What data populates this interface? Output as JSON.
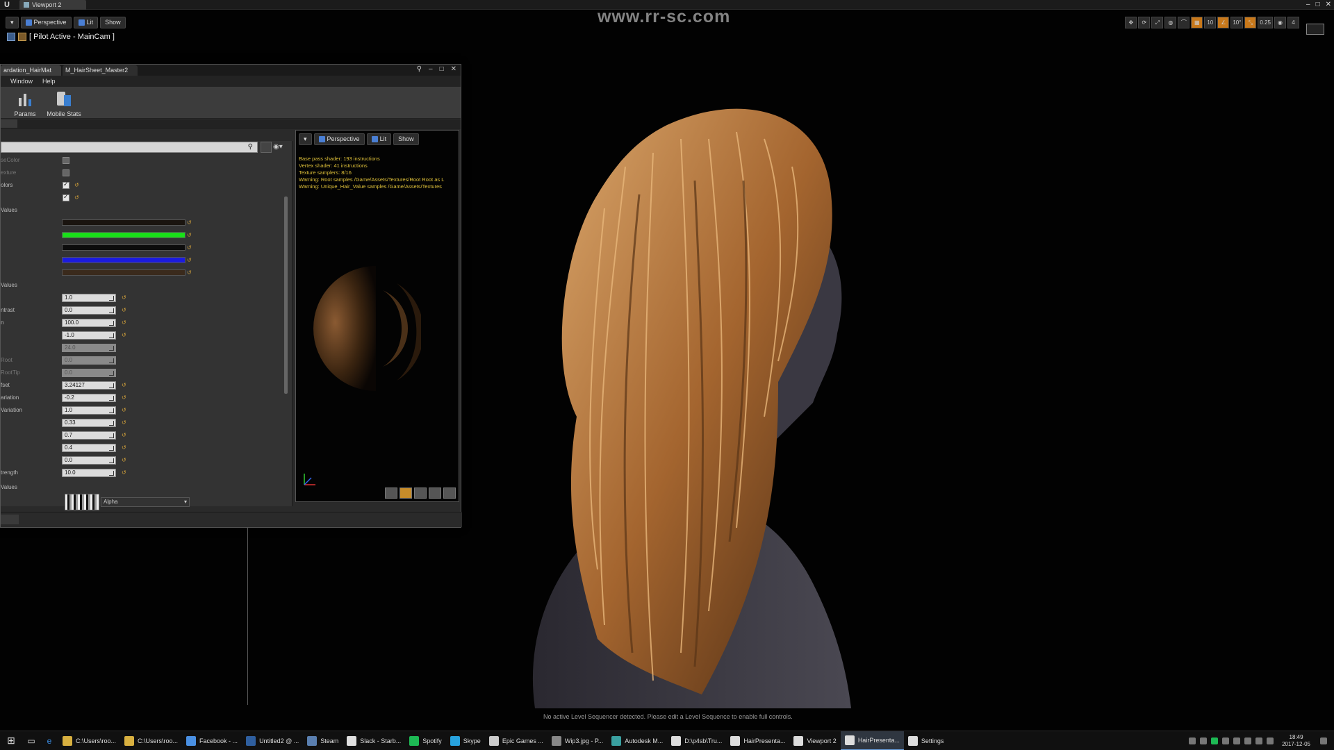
{
  "window": {
    "tab_title": "Viewport 2",
    "controls": [
      "–",
      "□",
      "✕"
    ]
  },
  "watermark": "www.rr-sc.com",
  "viewport": {
    "toolbar": {
      "perspective": "Perspective",
      "lit": "Lit",
      "show": "Show"
    },
    "pilot_label": "[ Pilot Active - MainCam ]",
    "right_toolbar": [
      "10",
      "10°",
      "0.25",
      "4"
    ],
    "status_message": "No active Level Sequencer detected. Please edit a Level Sequence to enable full controls."
  },
  "material_editor": {
    "tabs": [
      "ardation_HairMat",
      "M_HairSheet_Master2"
    ],
    "menu": {
      "window": "Window",
      "help": "Help"
    },
    "tools": {
      "params": "Params",
      "mobile_stats": "Mobile Stats"
    },
    "params": {
      "check_rows": [
        {
          "label": "seColor",
          "checked": false,
          "dim": true
        },
        {
          "label": "exture",
          "checked": false,
          "dim": true
        },
        {
          "label": "olors",
          "checked": true,
          "dim": false
        },
        {
          "label": "",
          "checked": true,
          "dim": false
        }
      ],
      "vector_header": "Values",
      "vector_colors": [
        "#1a140f",
        "#19e019",
        "#0c0c0c",
        "#1b1be0",
        "#3a2a1c"
      ],
      "scalar_header": "Values",
      "scalar_rows": [
        {
          "label": "",
          "value": "1.0",
          "dim": false
        },
        {
          "label": "ntrast",
          "value": "0.0",
          "dim": false
        },
        {
          "label": "n",
          "value": "100.0",
          "dim": false
        },
        {
          "label": "",
          "value": "-1.0",
          "dim": false
        },
        {
          "label": "",
          "value": "24.0",
          "dim": true
        },
        {
          "label": "Root",
          "value": "0.0",
          "dim": true
        },
        {
          "label": "RootTip",
          "value": "0.0",
          "dim": true
        },
        {
          "label": "fset",
          "value": "3.24127",
          "dim": false
        },
        {
          "label": "ariation",
          "value": "-0.2",
          "dim": false
        },
        {
          "label": "Variation",
          "value": "1.0",
          "dim": false
        },
        {
          "label": "",
          "value": "0.33",
          "dim": false
        },
        {
          "label": "",
          "value": "0.7",
          "dim": false
        },
        {
          "label": "",
          "value": "0.4",
          "dim": false
        },
        {
          "label": "",
          "value": "0.0",
          "dim": false
        },
        {
          "label": "trength",
          "value": "10.0",
          "dim": false
        }
      ],
      "texture_header": "Values",
      "texture_channel": "Alpha"
    },
    "preview": {
      "toolbar": {
        "perspective": "Perspective",
        "lit": "Lit",
        "show": "Show"
      },
      "stats": [
        "Base pass shader: 193 instructions",
        "Vertex shader: 41 instructions",
        "Texture samplers: 8/16",
        "Warning: Root samples /Game/Assets/Textures/Root Root as L",
        "Warning: Unique_Hair_Value samples /Game/Assets/Textures"
      ]
    }
  },
  "taskbar": {
    "items": [
      {
        "label": "C:\\Users\\roo...",
        "color": "#d8b040"
      },
      {
        "label": "C:\\Users\\roo...",
        "color": "#d8b040"
      },
      {
        "label": "Facebook - ...",
        "color": "#4a90e2"
      },
      {
        "label": "Untitled2 @ ...",
        "color": "#2f5f9f"
      },
      {
        "label": "Steam",
        "color": "#5a7fb0"
      },
      {
        "label": "Slack - Starb...",
        "color": "#e0e0e0"
      },
      {
        "label": "Spotify",
        "color": "#1db954"
      },
      {
        "label": "Skype",
        "color": "#27a2de"
      },
      {
        "label": "Epic Games ...",
        "color": "#cccccc"
      },
      {
        "label": "Wip3.jpg - P...",
        "color": "#888888"
      },
      {
        "label": "Autodesk M...",
        "color": "#3aa0a0"
      },
      {
        "label": "D:\\p4sb\\Tru...",
        "color": "#dddddd"
      },
      {
        "label": "HairPresenta...",
        "color": "#dddddd"
      },
      {
        "label": "Viewport 2",
        "color": "#dddddd"
      },
      {
        "label": "HairPresenta...",
        "color": "#dddddd"
      },
      {
        "label": "Settings",
        "color": "#dddddd"
      }
    ],
    "active_index": 14,
    "clock_time": "18:49",
    "clock_date": "2017-12-05"
  }
}
